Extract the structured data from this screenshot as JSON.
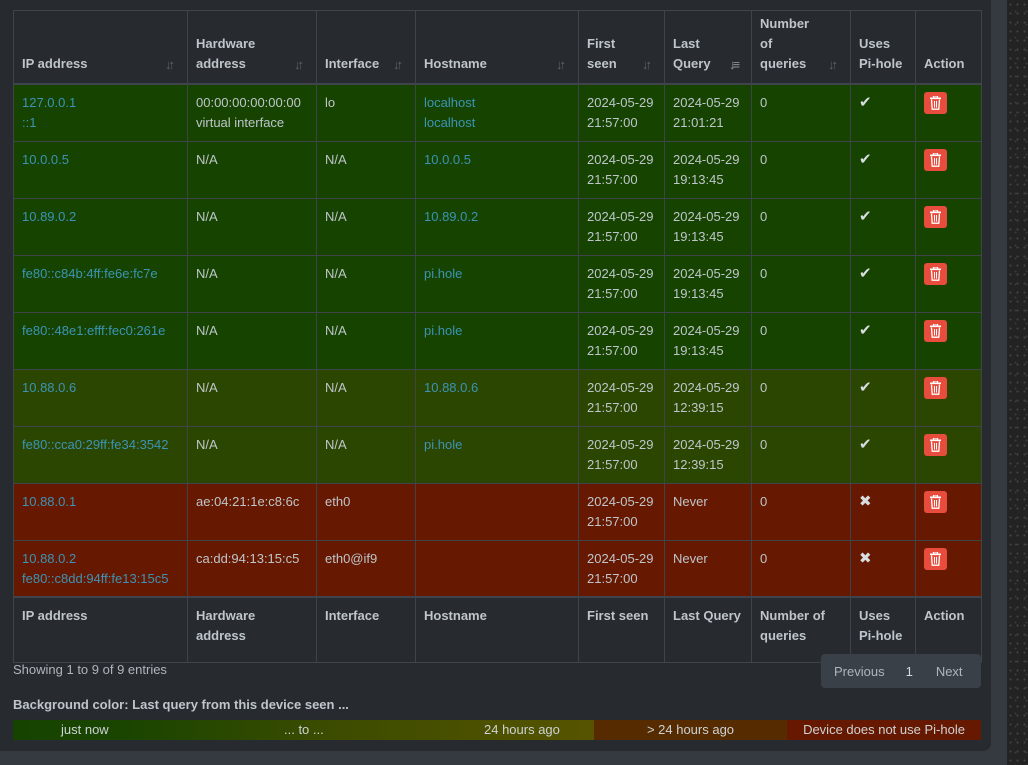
{
  "table": {
    "columns": [
      {
        "label": "IP address",
        "sortable": true,
        "active": false
      },
      {
        "label": "Hardware address",
        "sortable": true,
        "active": false
      },
      {
        "label": "Interface",
        "sortable": true,
        "active": false
      },
      {
        "label": "Hostname",
        "sortable": true,
        "active": false
      },
      {
        "label": "First seen",
        "sortable": true,
        "active": false
      },
      {
        "label": "Last Query",
        "sortable": true,
        "active": true
      },
      {
        "label": "Number of queries",
        "sortable": true,
        "active": false
      },
      {
        "label": "Uses Pi-hole",
        "sortable": false
      },
      {
        "label": "Action",
        "sortable": false
      }
    ],
    "rows": [
      {
        "ip": [
          "127.0.0.1",
          "::1"
        ],
        "hw": [
          "00:00:00:00:00:00",
          "virtual interface"
        ],
        "iface": "lo",
        "host": [
          "localhost",
          "localhost"
        ],
        "first_seen": [
          "2024-05-29",
          "21:57:00"
        ],
        "last_query": [
          "2024-05-29",
          "21:01:21"
        ],
        "queries": "0",
        "uses_pihole": "check-icon",
        "color": "#164400"
      },
      {
        "ip": [
          "10.0.0.5"
        ],
        "hw": [
          "N/A"
        ],
        "iface": "N/A",
        "host": [
          "10.0.0.5"
        ],
        "first_seen": [
          "2024-05-29",
          "21:57:00"
        ],
        "last_query": [
          "2024-05-29",
          "19:13:45"
        ],
        "queries": "0",
        "uses_pihole": "check-icon",
        "color": "#164400"
      },
      {
        "ip": [
          "10.89.0.2"
        ],
        "hw": [
          "N/A"
        ],
        "iface": "N/A",
        "host": [
          "10.89.0.2"
        ],
        "first_seen": [
          "2024-05-29",
          "21:57:00"
        ],
        "last_query": [
          "2024-05-29",
          "19:13:45"
        ],
        "queries": "0",
        "uses_pihole": "check-icon",
        "color": "#164400"
      },
      {
        "ip": [
          "fe80::c84b:4ff:fe6e:fc7e"
        ],
        "hw": [
          "N/A"
        ],
        "iface": "N/A",
        "host": [
          "pi.hole"
        ],
        "first_seen": [
          "2024-05-29",
          "21:57:00"
        ],
        "last_query": [
          "2024-05-29",
          "19:13:45"
        ],
        "queries": "0",
        "uses_pihole": "check-icon",
        "color": "#164400"
      },
      {
        "ip": [
          "fe80::48e1:efff:fec0:261e"
        ],
        "hw": [
          "N/A"
        ],
        "iface": "N/A",
        "host": [
          "pi.hole"
        ],
        "first_seen": [
          "2024-05-29",
          "21:57:00"
        ],
        "last_query": [
          "2024-05-29",
          "19:13:45"
        ],
        "queries": "0",
        "uses_pihole": "check-icon",
        "color": "#164400"
      },
      {
        "ip": [
          "10.88.0.6"
        ],
        "hw": [
          "N/A"
        ],
        "iface": "N/A",
        "host": [
          "10.88.0.6"
        ],
        "first_seen": [
          "2024-05-29",
          "21:57:00"
        ],
        "last_query": [
          "2024-05-29",
          "12:39:15"
        ],
        "queries": "0",
        "uses_pihole": "check-icon",
        "color": "#2b4600"
      },
      {
        "ip": [
          "fe80::cca0:29ff:fe34:3542"
        ],
        "hw": [
          "N/A"
        ],
        "iface": "N/A",
        "host": [
          "pi.hole"
        ],
        "first_seen": [
          "2024-05-29",
          "21:57:00"
        ],
        "last_query": [
          "2024-05-29",
          "12:39:15"
        ],
        "queries": "0",
        "uses_pihole": "check-icon",
        "color": "#2b4600"
      },
      {
        "ip": [
          "10.88.0.1"
        ],
        "hw": [
          "ae:04:21:1e:c8:6c"
        ],
        "iface": "eth0",
        "host": [],
        "first_seen": [
          "2024-05-29",
          "21:57:00"
        ],
        "last_query": [
          "Never"
        ],
        "queries": "0",
        "uses_pihole": "cross-icon",
        "color": "#661900"
      },
      {
        "ip": [
          "10.88.0.2",
          "fe80::c8dd:94ff:fe13:15c5"
        ],
        "hw": [
          "ca:dd:94:13:15:c5"
        ],
        "iface": "eth0@if9",
        "host": [],
        "first_seen": [
          "2024-05-29",
          "21:57:00"
        ],
        "last_query": [
          "Never"
        ],
        "queries": "0",
        "uses_pihole": "cross-icon",
        "color": "#661900"
      }
    ]
  },
  "info": "Showing 1 to 9 of 9 entries",
  "pagination": {
    "previous": "Previous",
    "page": "1",
    "next": "Next"
  },
  "legend": {
    "title": "Background color: Last query from this device seen ...",
    "just_now": "just now",
    "to": "... to ...",
    "hours24": "24 hours ago",
    "older": "> 24 hours ago",
    "no_pihole": "Device does not use Pi-hole",
    "colors": {
      "recent": "#164400",
      "mid": "#565400",
      "old": "#562b00",
      "none": "#661900"
    }
  },
  "colors": {
    "link": "#3c93b5",
    "delete_button": "#e74c3c"
  }
}
